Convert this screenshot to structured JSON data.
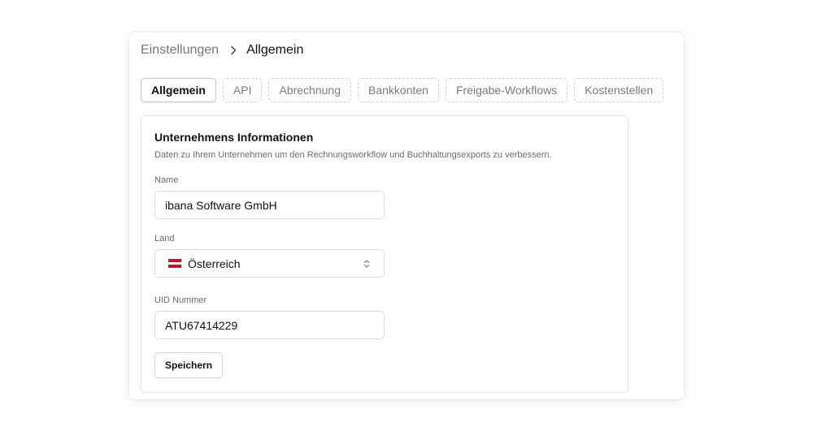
{
  "breadcrumb": {
    "parent": "Einstellungen",
    "current": "Allgemein"
  },
  "tabs": [
    {
      "label": "Allgemein",
      "active": true
    },
    {
      "label": "API",
      "active": false
    },
    {
      "label": "Abrechnung",
      "active": false
    },
    {
      "label": "Bankkonten",
      "active": false
    },
    {
      "label": "Freigabe-Workflows",
      "active": false
    },
    {
      "label": "Kostenstellen",
      "active": false
    }
  ],
  "card": {
    "title": "Unternehmens Informationen",
    "description": "Daten zu Ihrem Unternehmen um den Rechnungsworkflow und Buchhaltungsexports zu verbessern.",
    "fields": {
      "name": {
        "label": "Name",
        "value": "ibana Software GmbH"
      },
      "country": {
        "label": "Land",
        "value": "Österreich",
        "flag_icon": "austria-flag-icon",
        "flag_colors": [
          "#c8102e",
          "#ffffff",
          "#c8102e"
        ]
      },
      "uid": {
        "label": "UID Nummer",
        "value": "ATU67414229"
      }
    },
    "save_label": "Speichern"
  },
  "icons": {
    "breadcrumb_separator": "chevron-right-icon",
    "select_indicator": "chevron-up-down-icon"
  }
}
